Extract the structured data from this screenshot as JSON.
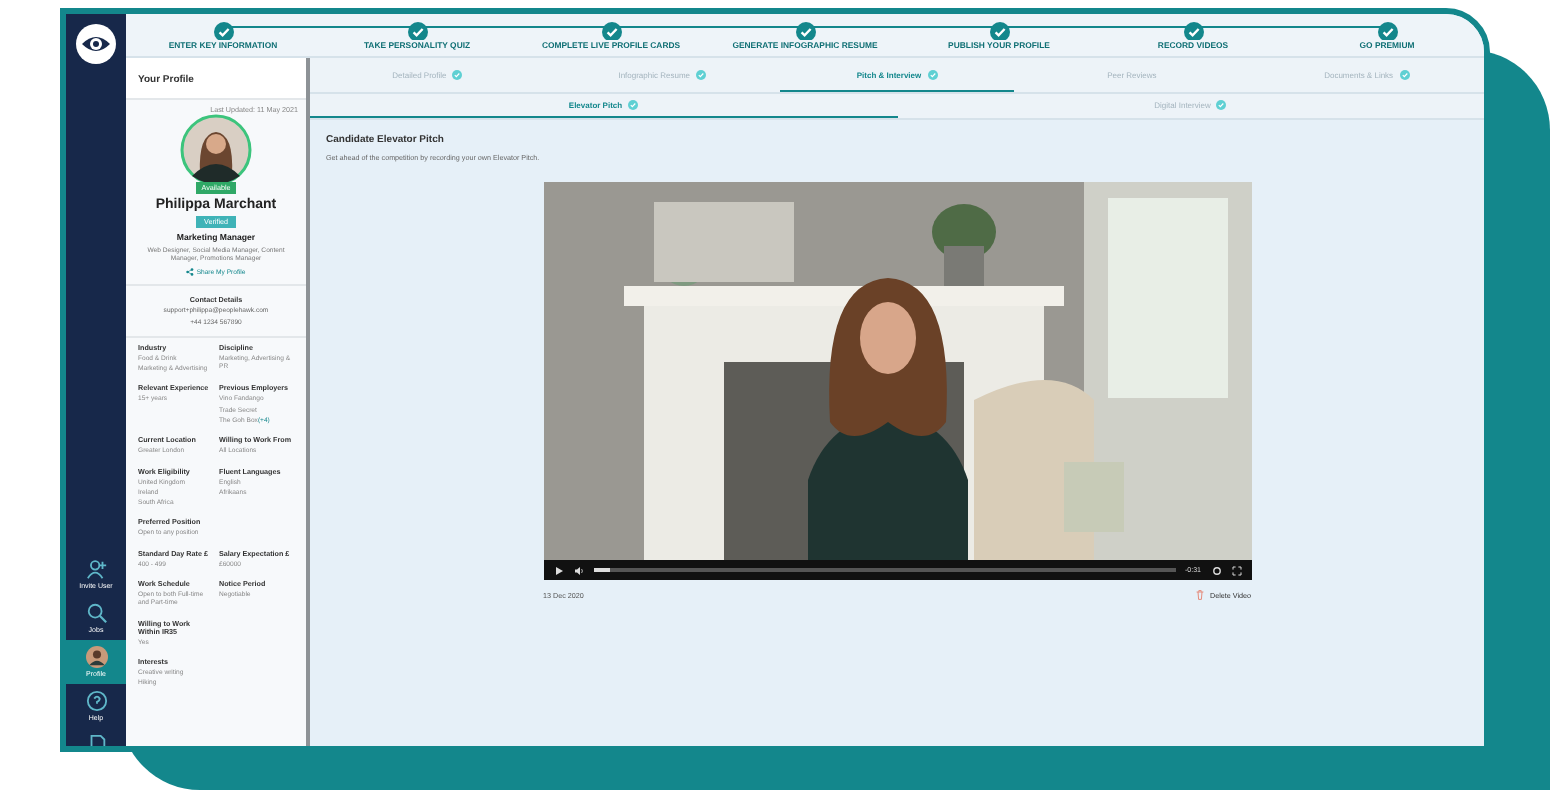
{
  "stepper": [
    {
      "label": "ENTER KEY INFORMATION",
      "done": true
    },
    {
      "label": "TAKE PERSONALITY QUIZ",
      "done": true
    },
    {
      "label": "COMPLETE LIVE PROFILE CARDS",
      "done": true
    },
    {
      "label": "GENERATE INFOGRAPHIC RESUME",
      "done": true
    },
    {
      "label": "PUBLISH YOUR PROFILE",
      "done": true
    },
    {
      "label": "RECORD VIDEOS",
      "done": true
    },
    {
      "label": "GO PREMIUM",
      "done": true
    }
  ],
  "nav": [
    {
      "kind": "invite",
      "label": "Invite User",
      "selected": false
    },
    {
      "kind": "jobs",
      "label": "Jobs",
      "selected": false
    },
    {
      "kind": "avatar",
      "label": "Profile",
      "selected": true
    },
    {
      "kind": "help",
      "label": "Help",
      "selected": false
    },
    {
      "kind": "docs",
      "selected": false
    }
  ],
  "profile": {
    "title": "Your Profile",
    "last_updated": "Last Updated: 11 May 2021",
    "status_badge": "Available",
    "name": "Philippa Marchant",
    "tag": "Verified",
    "headline": "Marketing Manager",
    "roles": "Web Designer, Social Media Manager, Content Manager, Promotions Manager",
    "share": "Share My Profile",
    "contact": {
      "heading": "Contact Details",
      "email": "support+philippa@peoplehawk.com",
      "phone": "+44 1234 567890"
    },
    "fields": [
      [
        {
          "label": "Industry",
          "values": [
            {
              "text": "Food & Drink"
            },
            {
              "text": "Marketing & Advertising"
            }
          ]
        },
        {
          "label": "Discipline",
          "values": [
            {
              "text": "Marketing, Advertising & PR"
            }
          ]
        }
      ],
      [
        {
          "label": "Relevant Experience",
          "values": [
            {
              "text": "15+ years"
            }
          ]
        },
        {
          "label": "Previous Employers",
          "values": [
            {
              "text": "Vino Fandango"
            },
            {
              "text": "Trade Secret"
            },
            {
              "text": "The Goh Box",
              "more": "(+4)"
            }
          ]
        }
      ],
      [
        {
          "label": "Current Location",
          "values": [
            {
              "text": "Greater London"
            }
          ]
        },
        {
          "label": "Willing to Work From",
          "values": [
            {
              "text": "All Locations"
            }
          ]
        }
      ],
      [
        {
          "label": "Work Eligibility",
          "values": [
            {
              "text": "United Kingdom"
            },
            {
              "text": "Ireland"
            },
            {
              "text": "South Africa"
            }
          ]
        },
        {
          "label": "Fluent Languages",
          "values": [
            {
              "text": "English"
            },
            {
              "text": "Afrikaans"
            }
          ]
        }
      ],
      [
        {
          "label": "Preferred Position",
          "values": [
            {
              "text": "Open to any position"
            }
          ]
        }
      ],
      [
        {
          "label": "Standard Day Rate £",
          "values": [
            {
              "text": "400 - 499"
            }
          ]
        },
        {
          "label": "Salary Expectation £",
          "values": [
            {
              "text": "£60000"
            }
          ]
        }
      ],
      [
        {
          "label": "Work Schedule",
          "values": [
            {
              "text": "Open to both Full-time and Part-time"
            }
          ]
        },
        {
          "label": "Notice Period",
          "values": [
            {
              "text": "Negotiable"
            }
          ]
        }
      ],
      [
        {
          "label": "Willing to Work Within IR35",
          "values": [
            {
              "text": "Yes"
            }
          ]
        }
      ],
      [
        {
          "label": "Interests",
          "values": [
            {
              "text": "Creative writing"
            },
            {
              "text": "Hiking"
            }
          ]
        }
      ]
    ]
  },
  "tabs": [
    {
      "label": "Detailed Profile",
      "done": true,
      "selected": false
    },
    {
      "label": "Infographic Resume",
      "done": true,
      "selected": false
    },
    {
      "label": "Pitch & Interview",
      "done": true,
      "selected": true
    },
    {
      "label": "Peer Reviews",
      "done": false,
      "selected": false
    },
    {
      "label": "Documents & Links",
      "done": true,
      "selected": false
    }
  ],
  "subtabs": [
    {
      "label": "Elevator Pitch",
      "done": true,
      "selected": true
    },
    {
      "label": "Digital Interview",
      "done": true,
      "selected": false
    }
  ],
  "content": {
    "title": "Candidate Elevator Pitch",
    "subtitle": "Get ahead of the competition by recording your own Elevator Pitch."
  },
  "video": {
    "level": 0.03,
    "time": "-0:31",
    "date": "13 Dec 2020",
    "delete": "Delete Video"
  }
}
